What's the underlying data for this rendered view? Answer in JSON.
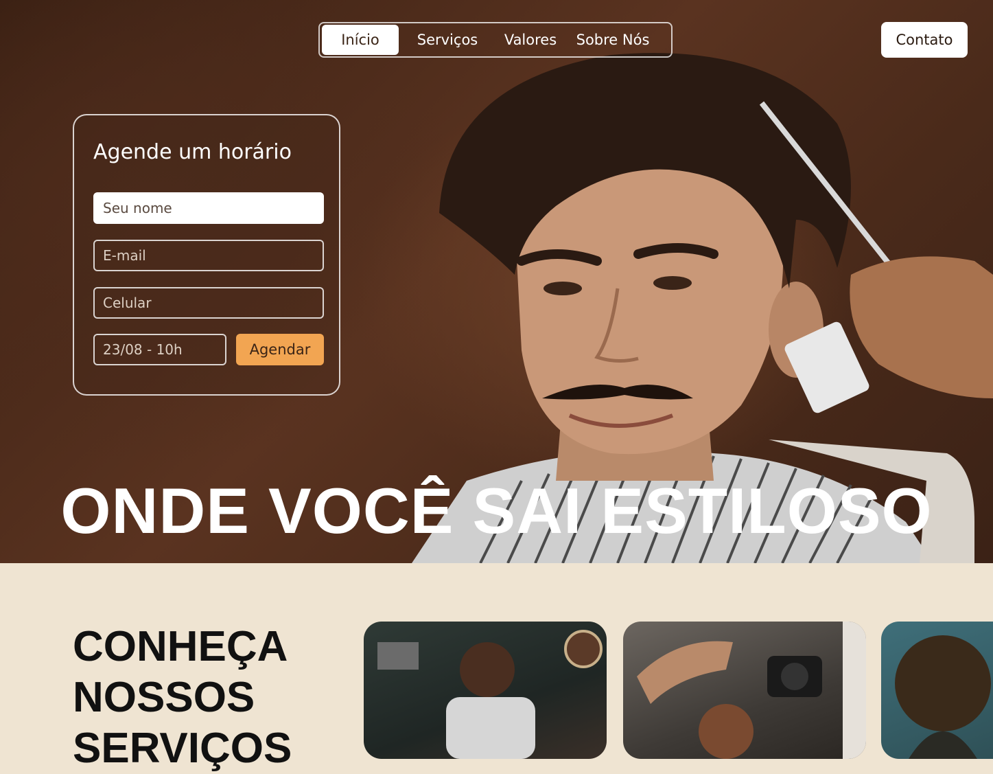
{
  "nav": {
    "items": [
      {
        "label": "Início",
        "active": true
      },
      {
        "label": "Serviços",
        "active": false
      },
      {
        "label": "Valores",
        "active": false
      },
      {
        "label": "Sobre Nós",
        "active": false
      }
    ],
    "contact_label": "Contato"
  },
  "booking": {
    "title": "Agende um horário",
    "name_placeholder": "Seu nome",
    "email_placeholder": "E-mail",
    "phone_placeholder": "Celular",
    "date_value": "23/08 - 10h",
    "submit_label": "Agendar"
  },
  "hero": {
    "headline": "ONDE VOCÊ SAI ESTILOSO"
  },
  "services": {
    "title": "CONHEÇA\nNOSSOS\nSERVIÇOS"
  },
  "colors": {
    "accent": "#f2a552",
    "hero_background": "#4a2a1a",
    "section_background": "#efe4d2"
  }
}
